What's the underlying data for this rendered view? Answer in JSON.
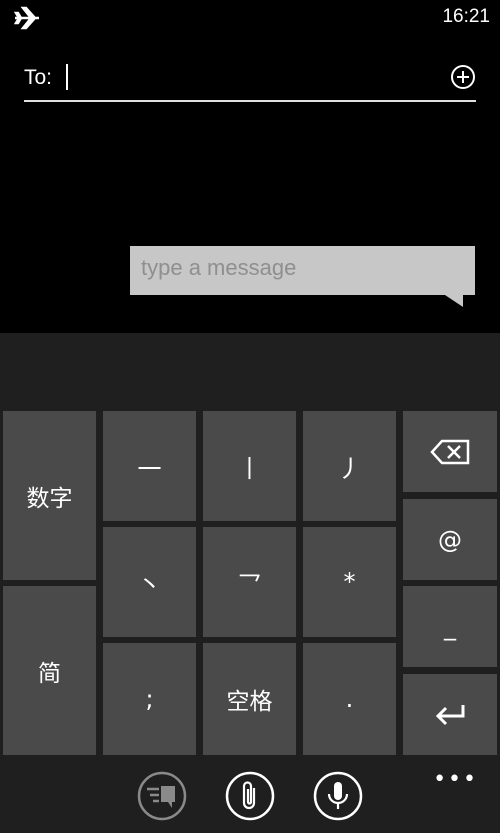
{
  "status_bar": {
    "time": "16:21",
    "airplane_icon": "airplane-icon"
  },
  "compose": {
    "to_label": "To:",
    "add_icon": "add-circle-icon",
    "message_placeholder": "type a message"
  },
  "keyboard": {
    "left_keys": {
      "numbers": "数字",
      "mode": "简"
    },
    "row1": [
      "一",
      "丨",
      "丿"
    ],
    "row2": [
      "丶",
      "乛",
      "*"
    ],
    "row3": [
      ";",
      "空格",
      "."
    ],
    "right_keys": {
      "backspace_icon": "backspace-icon",
      "at": "@",
      "dash": "_",
      "enter_icon": "enter-icon"
    }
  },
  "app_bar": {
    "buttons": [
      "emoticons-icon",
      "attach-icon",
      "microphone-icon"
    ],
    "more": "•••"
  },
  "colors": {
    "background": "#000000",
    "keyboard_bg": "#1f1f1f",
    "key": "#4a4a4a",
    "bubble": "#c7c7c7",
    "placeholder": "#8f8f8f"
  }
}
